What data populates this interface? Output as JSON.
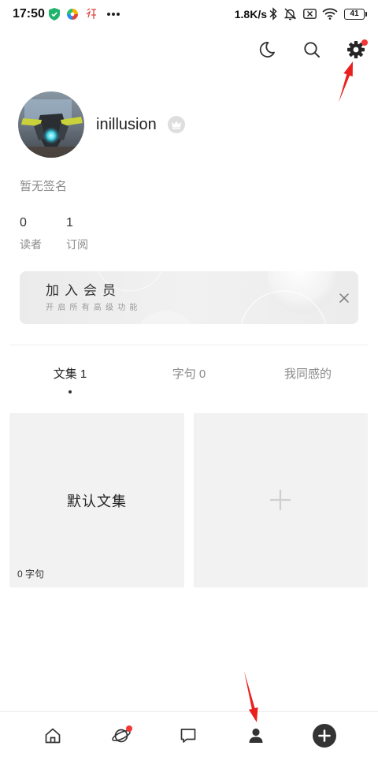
{
  "status_bar": {
    "time": "17:50",
    "net_speed": "1.8K/s",
    "battery": "41",
    "icons": [
      "shield-icon",
      "app-colorful-icon",
      "app-red-icon",
      "more-dots-icon",
      "bluetooth-icon",
      "bell-off-icon",
      "sim-off-icon",
      "wifi-icon",
      "battery-icon"
    ]
  },
  "toolbar": {
    "icons": [
      "moon-icon",
      "search-icon",
      "gear-icon"
    ],
    "settings_badge": true
  },
  "profile": {
    "username": "inillusion",
    "badge_icon": "crown-icon",
    "signature": "暂无签名",
    "stats": [
      {
        "value": "0",
        "label": "读者"
      },
      {
        "value": "1",
        "label": "订阅"
      }
    ]
  },
  "membership_banner": {
    "title": "加入会员",
    "subtitle": "开启所有高级功能",
    "close_icon": "close-icon"
  },
  "tabs": [
    {
      "label": "文集 1",
      "active": true
    },
    {
      "label": "字句 0",
      "active": false
    },
    {
      "label": "我同感的",
      "active": false
    }
  ],
  "collections": [
    {
      "title": "默认文集",
      "count": "0 字句"
    }
  ],
  "add_collection": {
    "icon": "plus-icon"
  },
  "bottom_nav": {
    "items": [
      {
        "icon": "home-icon"
      },
      {
        "icon": "planet-icon",
        "badge": true
      },
      {
        "icon": "chat-icon"
      },
      {
        "icon": "person-icon",
        "active": true
      },
      {
        "icon": "add-circle-icon"
      }
    ]
  },
  "colors": {
    "badge": "#f23535",
    "annotation_arrow": "#e8211f",
    "text_primary": "#222222",
    "text_secondary": "#8a8a8a",
    "card_background": "#f2f2f2"
  }
}
